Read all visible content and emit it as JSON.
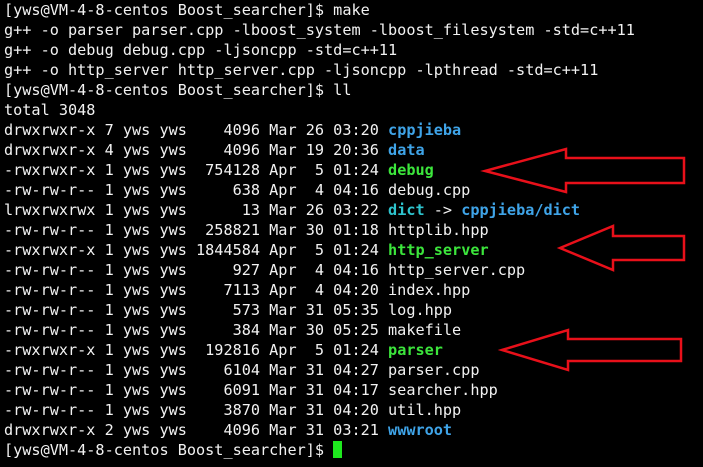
{
  "colors": {
    "background": "#000000",
    "text": "#f2f2f2",
    "directory": "#3fa4e8",
    "executable": "#3ce63c",
    "symlink": "#2ec4ce",
    "cursor": "#1ee81e",
    "annotation_arrow": "#e8101a"
  },
  "terminal": {
    "lines": [
      [
        {
          "text": "[yws@VM-4-8-centos Boost_searcher]$ make",
          "style": "plain"
        }
      ],
      [
        {
          "text": "g++ -o parser parser.cpp -lboost_system -lboost_filesystem -std=c++11",
          "style": "plain"
        }
      ],
      [
        {
          "text": "g++ -o debug debug.cpp -ljsoncpp -std=c++11",
          "style": "plain"
        }
      ],
      [
        {
          "text": "g++ -o http_server http_server.cpp -ljsoncpp -lpthread -std=c++11",
          "style": "plain"
        }
      ],
      [
        {
          "text": "[yws@VM-4-8-centos Boost_searcher]$ ll",
          "style": "plain"
        }
      ],
      [
        {
          "text": "total 3048",
          "style": "plain"
        }
      ],
      [
        {
          "text": "drwxrwxr-x 7 yws yws    4096 Mar 26 03:20 ",
          "style": "plain"
        },
        {
          "text": "cppjieba",
          "style": "dir"
        }
      ],
      [
        {
          "text": "drwxrwxr-x 4 yws yws    4096 Mar 19 20:36 ",
          "style": "plain"
        },
        {
          "text": "data",
          "style": "dir"
        }
      ],
      [
        {
          "text": "-rwxrwxr-x 1 yws yws  754128 Apr  5 01:24 ",
          "style": "plain"
        },
        {
          "text": "debug",
          "style": "exec"
        }
      ],
      [
        {
          "text": "-rw-rw-r-- 1 yws yws     638 Apr  4 04:16 debug.cpp",
          "style": "plain"
        }
      ],
      [
        {
          "text": "lrwxrwxrwx 1 yws yws      13 Mar 26 03:22 ",
          "style": "plain"
        },
        {
          "text": "dict",
          "style": "link"
        },
        {
          "text": " -> ",
          "style": "plain"
        },
        {
          "text": "cppjieba/dict",
          "style": "dir"
        }
      ],
      [
        {
          "text": "-rw-rw-r-- 1 yws yws  258821 Mar 30 01:18 httplib.hpp",
          "style": "plain"
        }
      ],
      [
        {
          "text": "-rwxrwxr-x 1 yws yws 1844584 Apr  5 01:24 ",
          "style": "plain"
        },
        {
          "text": "http_server",
          "style": "exec"
        }
      ],
      [
        {
          "text": "-rw-rw-r-- 1 yws yws     927 Apr  4 04:16 http_server.cpp",
          "style": "plain"
        }
      ],
      [
        {
          "text": "-rw-rw-r-- 1 yws yws    7113 Apr  4 04:20 index.hpp",
          "style": "plain"
        }
      ],
      [
        {
          "text": "-rw-rw-r-- 1 yws yws     573 Mar 31 05:35 log.hpp",
          "style": "plain"
        }
      ],
      [
        {
          "text": "-rw-rw-r-- 1 yws yws     384 Mar 30 05:25 makefile",
          "style": "plain"
        }
      ],
      [
        {
          "text": "-rwxrwxr-x 1 yws yws  192816 Apr  5 01:24 ",
          "style": "plain"
        },
        {
          "text": "parser",
          "style": "exec"
        }
      ],
      [
        {
          "text": "-rw-rw-r-- 1 yws yws    6104 Mar 31 04:27 parser.cpp",
          "style": "plain"
        }
      ],
      [
        {
          "text": "-rw-rw-r-- 1 yws yws    6091 Mar 31 04:17 searcher.hpp",
          "style": "plain"
        }
      ],
      [
        {
          "text": "-rw-rw-r-- 1 yws yws    3870 Mar 31 04:20 util.hpp",
          "style": "plain"
        }
      ],
      [
        {
          "text": "drwxrwxr-x 2 yws yws    4096 Mar 31 03:21 ",
          "style": "plain"
        },
        {
          "text": "wwwroot",
          "style": "dir"
        }
      ],
      [
        {
          "text": "[yws@VM-4-8-centos Boost_searcher]$ ",
          "style": "plain"
        },
        {
          "text": "",
          "style": "cursor"
        }
      ]
    ]
  },
  "annotations": {
    "arrows": [
      {
        "points_to": "debug"
      },
      {
        "points_to": "http_server"
      },
      {
        "points_to": "parser"
      }
    ]
  }
}
